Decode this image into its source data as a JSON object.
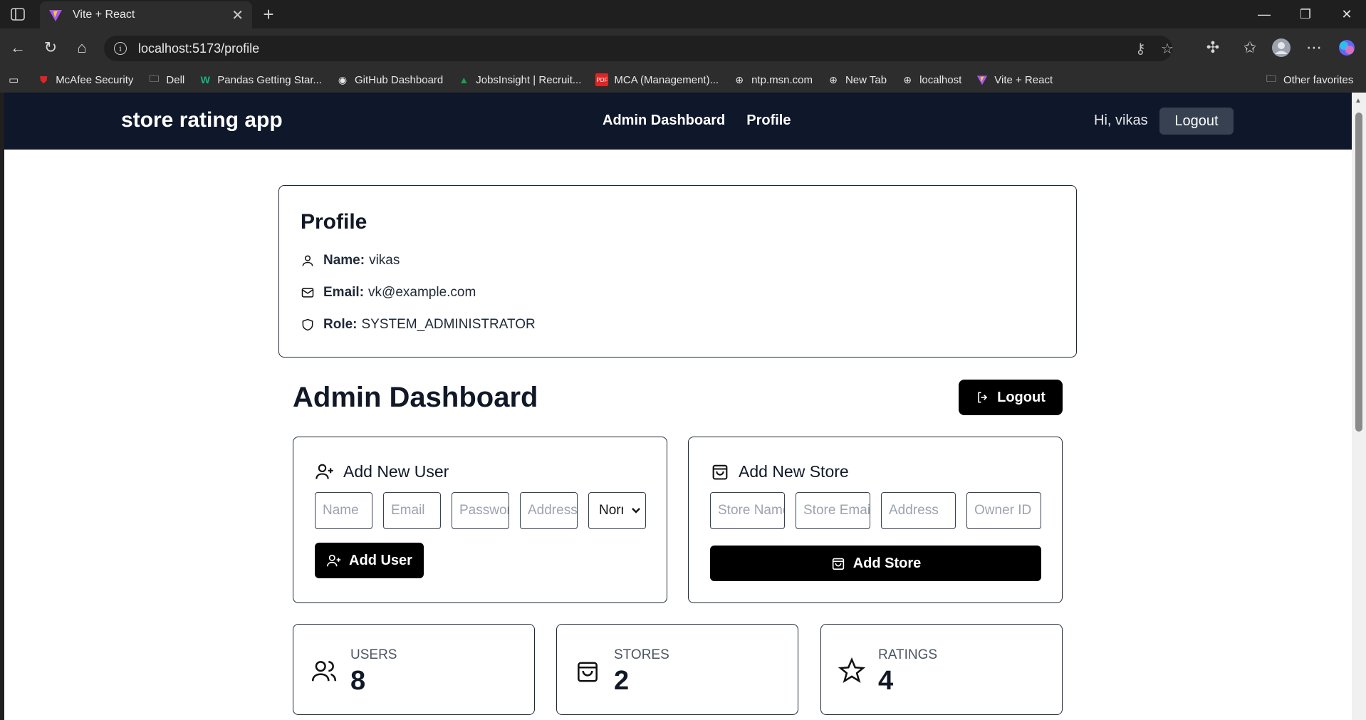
{
  "browser": {
    "tab_title": "Vite + React",
    "url": "localhost:5173/profile",
    "bookmarks": [
      {
        "label": "McAfee Security",
        "icon": "mcafee-icon"
      },
      {
        "label": "Dell",
        "icon": "folder-icon"
      },
      {
        "label": "Pandas Getting Star...",
        "icon": "w-icon"
      },
      {
        "label": "GitHub Dashboard",
        "icon": "github-icon"
      },
      {
        "label": "JobsInsight | Recruit...",
        "icon": "jobs-icon"
      },
      {
        "label": "MCA (Management)...",
        "icon": "pdf-icon"
      },
      {
        "label": "ntp.msn.com",
        "icon": "globe-icon"
      },
      {
        "label": "New Tab",
        "icon": "globe-icon"
      },
      {
        "label": "localhost",
        "icon": "globe-icon"
      },
      {
        "label": "Vite + React",
        "icon": "vite-icon"
      }
    ],
    "other_favorites": "Other favorites"
  },
  "header": {
    "brand": "store rating app",
    "links": [
      "Admin Dashboard",
      "Profile"
    ],
    "greeting": "Hi, vikas",
    "logout_label": "Logout"
  },
  "profile": {
    "title": "Profile",
    "name_label": "Name:",
    "name": "vikas",
    "email_label": "Email:",
    "email": "vk@example.com",
    "role_label": "Role:",
    "role": "SYSTEM_ADMINISTRATOR"
  },
  "dashboard": {
    "title": "Admin Dashboard",
    "logout_label": "Logout",
    "add_user": {
      "title": "Add New User",
      "placeholders": [
        "Name",
        "Email",
        "Password",
        "Address"
      ],
      "role_select": "Normal",
      "button": "Add User"
    },
    "add_store": {
      "title": "Add New Store",
      "placeholders": [
        "Store Name",
        "Store Email",
        "Address",
        "Owner ID"
      ],
      "button": "Add Store"
    },
    "stats": [
      {
        "label": "USERS",
        "value": "8",
        "icon": "users-icon"
      },
      {
        "label": "STORES",
        "value": "2",
        "icon": "shopping-bag-icon"
      },
      {
        "label": "RATINGS",
        "value": "4",
        "icon": "star-icon"
      }
    ]
  }
}
